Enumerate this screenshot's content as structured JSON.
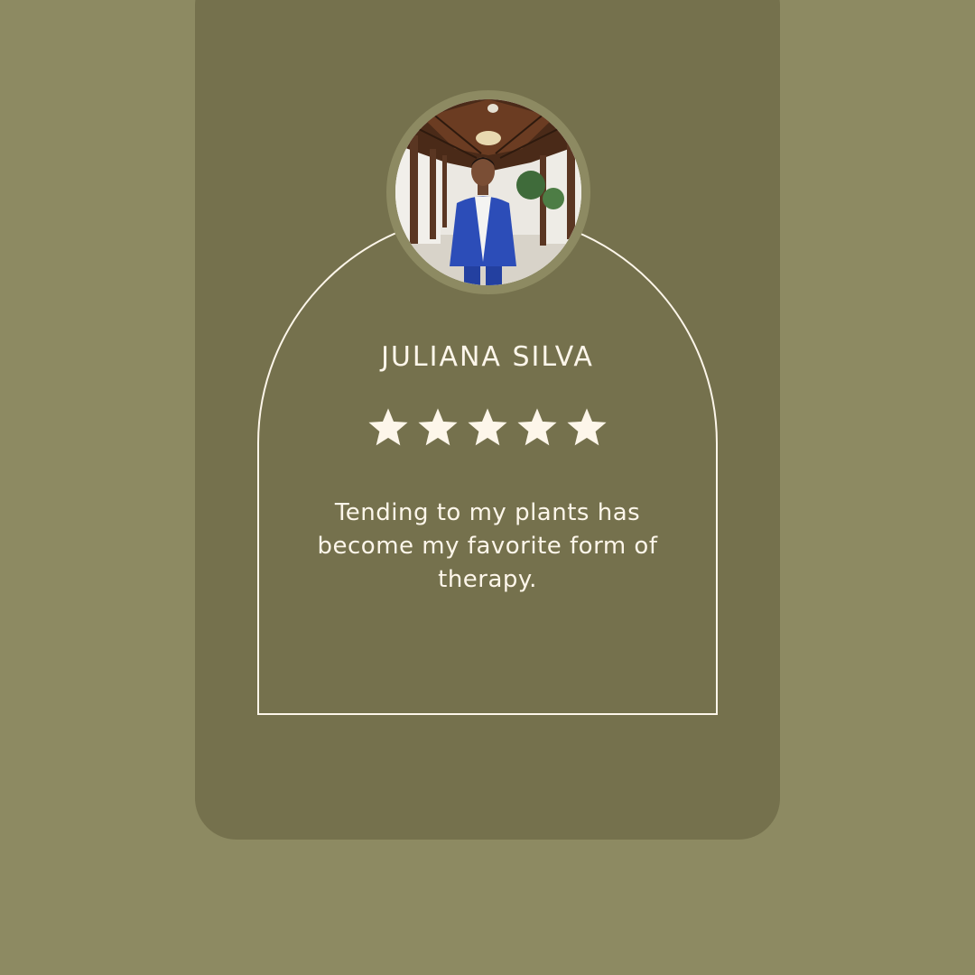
{
  "colors": {
    "background": "#8d8a62",
    "card": "#75714d",
    "foreground": "#fdf6ea"
  },
  "testimonial": {
    "avatar_icon": "person-photo-avatar",
    "name": "JULIANA SILVA",
    "rating": 5,
    "rating_max": 5,
    "star_icon": "star-icon",
    "quote": "Tending to my plants has become my favorite form of therapy."
  }
}
